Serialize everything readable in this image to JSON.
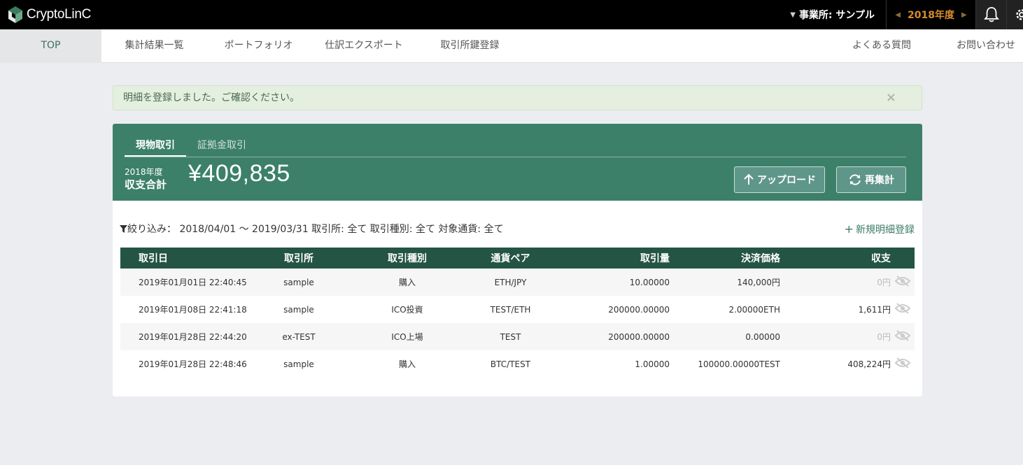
{
  "header": {
    "logo_text": "CryptoLinC",
    "office_label": "事業所: サンプル",
    "year": "2018年度"
  },
  "nav": {
    "top": "TOP",
    "summary": "集計結果一覧",
    "portfolio": "ポートフォリオ",
    "export": "仕訳エクスポート",
    "exchange_keys": "取引所鍵登録",
    "faq": "よくある質問",
    "contact": "お問い合わせ"
  },
  "alert": {
    "message": "明細を登録しました。ご確認ください。",
    "close": "×"
  },
  "card": {
    "tab_spot": "現物取引",
    "tab_margin": "証拠金取引",
    "year_label": "2018年度",
    "total_label": "収支合計",
    "total_value": "¥409,835",
    "upload_label": "アップロード",
    "recalc_label": "再集計",
    "filter_text": "絞り込み： 2018/04/01 〜 2019/03/31 取引所: 全て 取引種別: 全て 対象通貨: 全て",
    "add_label": "新規明細登録"
  },
  "table": {
    "headers": [
      "取引日",
      "取引所",
      "取引種別",
      "通貨ペア",
      "取引量",
      "決済価格",
      "収支"
    ],
    "rows": [
      {
        "date": "2019年01月01日 22:40:45",
        "exchange": "sample",
        "type": "購入",
        "pair": "ETH/JPY",
        "amount": "10.00000",
        "price": "140,000円",
        "pl": "0円"
      },
      {
        "date": "2019年01月08日 22:41:18",
        "exchange": "sample",
        "type": "ICO投資",
        "pair": "TEST/ETH",
        "amount": "200000.00000",
        "price": "2.00000ETH",
        "pl": "1,611円"
      },
      {
        "date": "2019年01月28日 22:44:20",
        "exchange": "ex-TEST",
        "type": "ICO上場",
        "pair": "TEST",
        "amount": "200000.00000",
        "price": "0.00000",
        "pl": "0円"
      },
      {
        "date": "2019年01月28日 22:48:46",
        "exchange": "sample",
        "type": "購入",
        "pair": "BTC/TEST",
        "amount": "1.00000",
        "price": "100000.00000TEST",
        "pl": "408,224円"
      }
    ]
  },
  "icons": {
    "logo": "cube-logo-icon",
    "bell": "bell-icon",
    "gear": "gear-icon",
    "filter": "funnel-icon",
    "upload": "arrow-up-icon",
    "recalc": "refresh-icon",
    "row_visibility": "eye-slash-icon"
  },
  "colors": {
    "accent_green": "#3c8069",
    "table_header": "#245443",
    "year_orange": "#d88c2c"
  }
}
